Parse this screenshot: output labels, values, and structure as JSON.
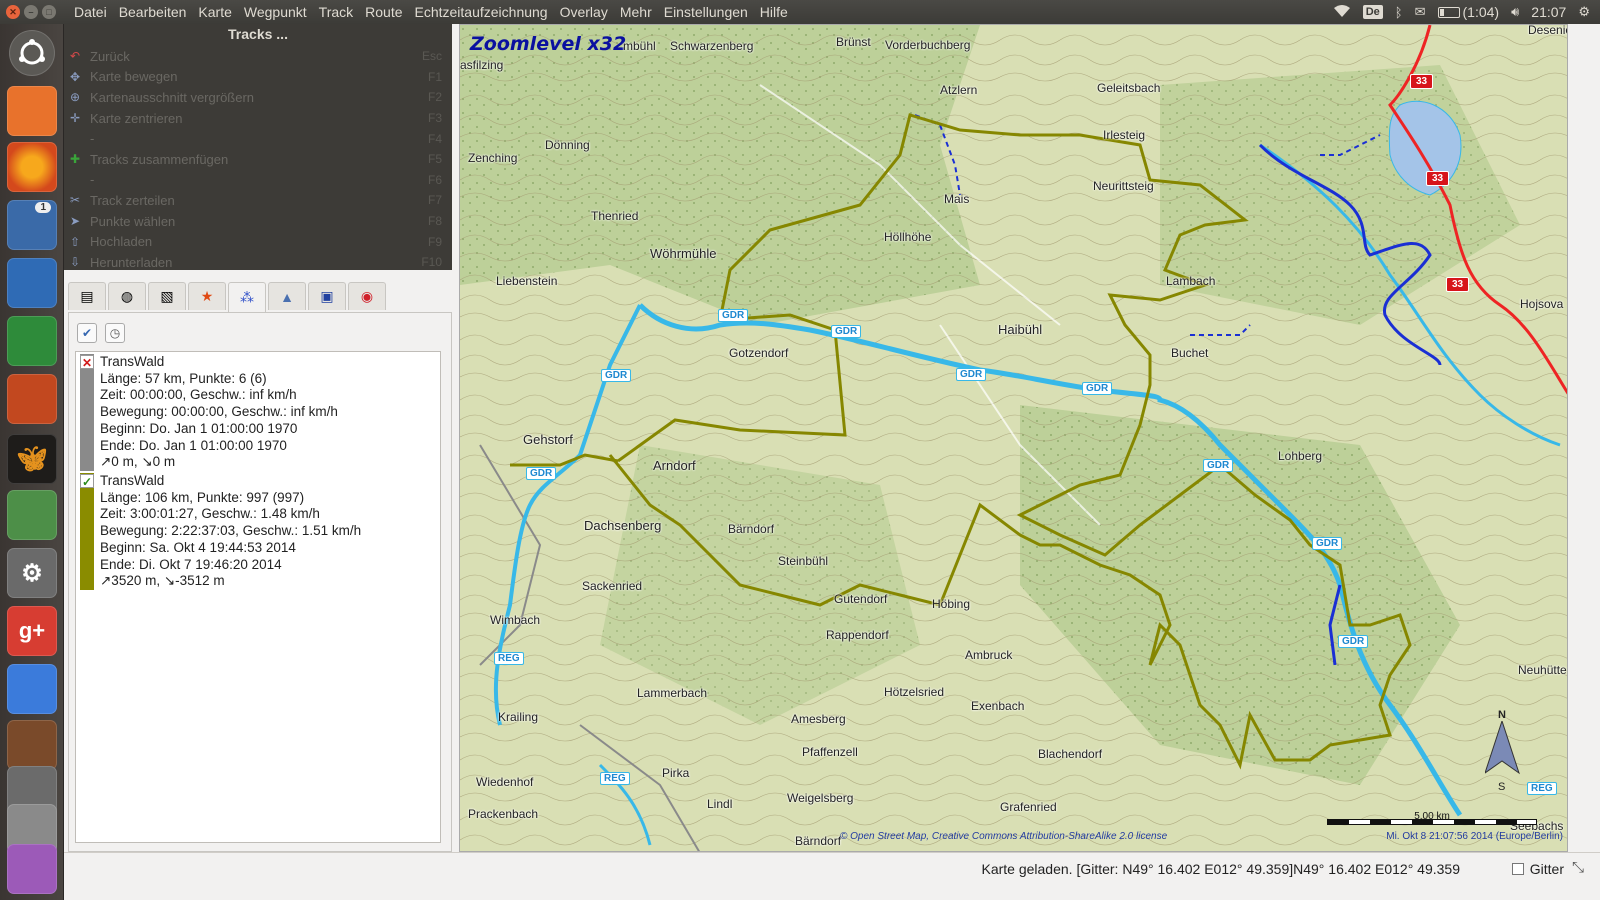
{
  "menu": [
    "Datei",
    "Bearbeiten",
    "Karte",
    "Wegpunkt",
    "Track",
    "Route",
    "Echtzeitaufzeichnung",
    "Overlay",
    "Mehr",
    "Einstellungen",
    "Hilfe"
  ],
  "tray": {
    "keyboard": "De",
    "battery": "(1:04)",
    "clock": "21:07"
  },
  "launcher": {
    "icons": [
      "dash-icon",
      "files-icon",
      "firefox-icon",
      "thunderbird-icon",
      "writer-icon",
      "calc-icon",
      "impress-icon",
      "viking-icon",
      "map-search-icon",
      "system-settings-icon",
      "google-plus-icon",
      "docs-icon",
      "library-icon",
      "scanner-icon",
      "printer-icon",
      "archive-icon"
    ],
    "badge": "1",
    "google_label": "g+"
  },
  "tools": {
    "title": "Tracks ...",
    "items": [
      {
        "label": "Zurück",
        "key": "Esc",
        "icon": "back-arrow-icon"
      },
      {
        "label": "Karte bewegen",
        "key": "F1",
        "icon": "move-icon"
      },
      {
        "label": "Kartenausschnitt vergrößern",
        "key": "F2",
        "icon": "zoom-icon"
      },
      {
        "label": "Karte zentrieren",
        "key": "F3",
        "icon": "center-icon"
      },
      {
        "label": "-",
        "key": "F4",
        "icon": ""
      },
      {
        "label": "Tracks zusammenfügen",
        "key": "F5",
        "icon": "plus-icon"
      },
      {
        "label": "-",
        "key": "F6",
        "icon": ""
      },
      {
        "label": "Track zerteilen",
        "key": "F7",
        "icon": "scissors-icon"
      },
      {
        "label": "Punkte wählen",
        "key": "F8",
        "icon": "pointer-icon"
      },
      {
        "label": "Hochladen",
        "key": "F9",
        "icon": "upload-icon"
      },
      {
        "label": "Herunterladen",
        "key": "F10",
        "icon": "download-icon"
      }
    ]
  },
  "tabs": [
    "overview-tab-icon",
    "globe-tab-icon",
    "map-tab-icon",
    "star-tab-icon",
    "tracks-tab-icon",
    "flask-tab-icon",
    "photo-tab-icon",
    "target-tab-icon"
  ],
  "tracks": [
    {
      "color": "#8a8a8a",
      "check": "✕",
      "check_color": "#d21919",
      "lines": [
        "TransWald",
        "Länge: 57 km, Punkte: 6 (6)",
        "Zeit:  00:00:00, Geschw.: inf km/h",
        "Bewegung: 00:00:00, Geschw.: inf km/h",
        "Beginn: Do. Jan 1 01:00:00 1970",
        "Ende: Do. Jan 1 01:00:00 1970",
        "↗0 m, ↘0 m"
      ]
    },
    {
      "color": "#8a8c00",
      "check": "✓",
      "check_color": "#2c8a1c",
      "lines": [
        "TransWald",
        "Länge: 106 km, Punkte: 997 (997)",
        "Zeit: 3:00:01:27, Geschw.: 1.48 km/h",
        "Bewegung: 2:22:37:03, Geschw.: 1.51 km/h",
        "Beginn: Sa. Okt 4 19:44:53 2014",
        "Ende: Di. Okt 7 19:46:20 2014",
        "↗3520 m, ↘-3512 m"
      ]
    }
  ],
  "map": {
    "zoom_label": "Zoomlevel x32",
    "attribution": "© Open Street Map, Creative Commons Attribution-ShareAlike 2.0 license",
    "timestamp": "Mi. Okt 8 21:07:56 2014 (Europe/Berlin)",
    "scale_label": "5.00 km",
    "compass_n": "N",
    "compass_s": "S",
    "places": [
      "Brünst",
      "Vorderbuchberg",
      "Desenice",
      "Schwarzenberg",
      "Atzlern",
      "Geleitsbach",
      "Irlesteig",
      "Neurittsteig",
      "Zenching",
      "Dönning",
      "Mais",
      "Thenried",
      "Höllhöhe",
      "Wöhrmühle",
      "Liebenstein",
      "Lambach",
      "Haibühl",
      "Buchet",
      "Gotzendorf",
      "Gehstorf",
      "Arndorf",
      "Lohberg",
      "Dachsenberg",
      "Bärndorf",
      "Steinbühl",
      "Sackenried",
      "Gutendorf",
      "Höbing",
      "Wimbach",
      "Rappendorf",
      "Ambruck",
      "Neuhütte",
      "Lammerbach",
      "Hötzelsried",
      "Exenbach",
      "Krailing",
      "Amesberg",
      "Pfaffenzell",
      "Blachendorf",
      "Wiedenhof",
      "Pirka",
      "Lindl",
      "Weigelsberg",
      "Grafenried",
      "Prackenbach",
      "Bärndorf",
      "Seebachs",
      "Hojsova",
      "asfilzing",
      "mbühl"
    ],
    "road_labels": [
      "33",
      "33",
      "33"
    ],
    "water_labels": [
      "GDR",
      "GDR",
      "GDR",
      "GDR",
      "GDR",
      "GDR",
      "GDR",
      "GDR",
      "GDR",
      "REG",
      "REG",
      "REG"
    ]
  },
  "status": {
    "text": "Karte geladen.  [Gitter: N49° 16.402 E012° 49.359]N49° 16.402 E012° 49.359",
    "grid_label": "Gitter"
  }
}
